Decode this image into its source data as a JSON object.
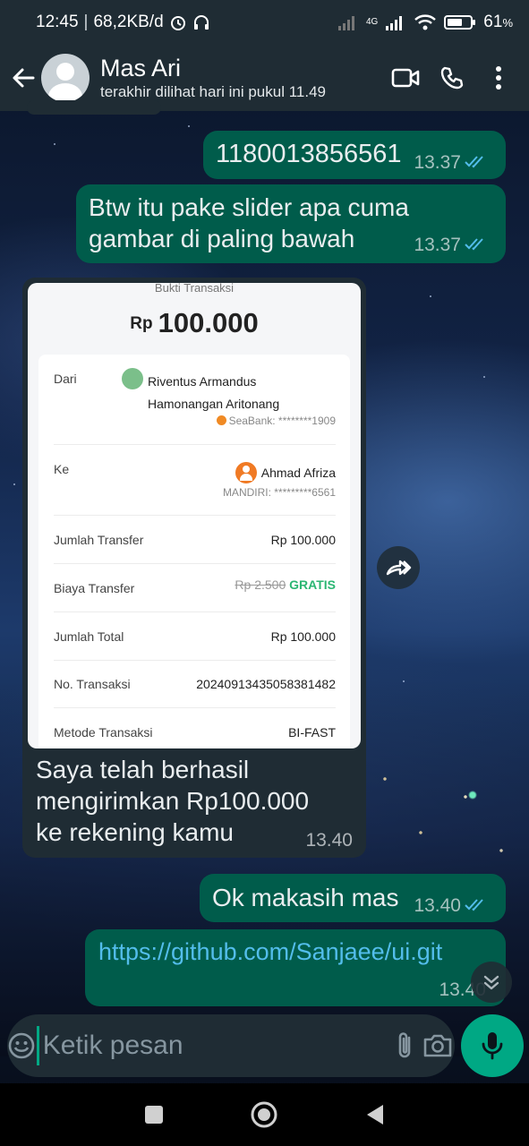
{
  "status_bar": {
    "time": "12:45",
    "data_rate": "68,2KB/d",
    "network": "4G",
    "battery": "61",
    "battery_unit": "%"
  },
  "header": {
    "contact_name": "Mas Ari",
    "last_seen": "terakhir dilihat hari ini pukul 11.49",
    "icons": [
      "back-arrow-icon",
      "video-call-icon",
      "phone-icon",
      "more-vert-icon"
    ]
  },
  "messages": [
    {
      "direction": "out",
      "text": "1180013856561",
      "time": "13.37",
      "read": true
    },
    {
      "direction": "out",
      "text": "Btw itu pake slider apa cuma gambar di paling bawah",
      "time": "13.37",
      "read": true
    },
    {
      "direction": "in",
      "type": "image",
      "caption": "Saya telah berhasil mengirimkan Rp100.000 ke rekening kamu",
      "time": "13.40"
    },
    {
      "direction": "out",
      "text": "Ok makasih mas",
      "time": "13.40",
      "read": true
    },
    {
      "direction": "out",
      "text": "https://github.com/Sanjaee/ui.git",
      "time": "13.40",
      "read": false
    }
  ],
  "receipt": {
    "title": "Bukti Transaksi",
    "currency": "Rp",
    "amount": "100.000",
    "from_label": "Dari",
    "from_name_line1": "Riventus Armandus",
    "from_name_line2": "Hamonangan Aritonang",
    "from_bank": "SeaBank: ********1909",
    "to_label": "Ke",
    "to_name": "Ahmad Afriza",
    "to_bank": "MANDIRI: *********6561",
    "rows": [
      {
        "label": "Jumlah Transfer",
        "value": "Rp 100.000"
      },
      {
        "label": "Biaya Transfer",
        "value_strike": "Rp 2.500",
        "value_extra": "GRATIS"
      },
      {
        "label": "Jumlah Total",
        "value": "Rp 100.000"
      },
      {
        "label": "No. Transaksi",
        "value": "20240913435058381482"
      },
      {
        "label": "Metode Transaksi",
        "value": "BI-FAST"
      }
    ]
  },
  "composer": {
    "placeholder": "Ketik pesan"
  },
  "colors": {
    "header_bg": "#1f2c34",
    "outgoing_bubble": "#005c4b",
    "incoming_bubble": "#1f2c34",
    "accent_green": "#00a884",
    "read_ticks": "#53bdeb",
    "link": "#53bdeb"
  }
}
